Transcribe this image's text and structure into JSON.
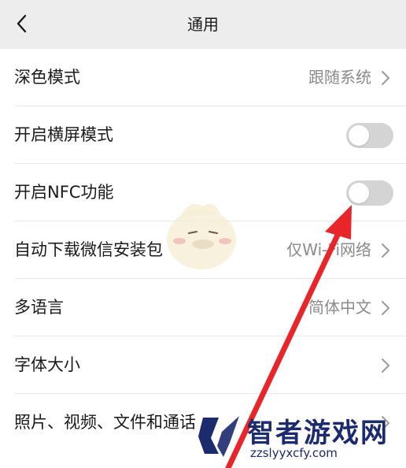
{
  "header": {
    "title": "通用"
  },
  "settings": [
    {
      "label": "深色模式",
      "value": "跟随系统",
      "type": "nav"
    },
    {
      "label": "开启横屏模式",
      "type": "toggle",
      "on": false
    },
    {
      "label": "开启NFC功能",
      "type": "toggle",
      "on": false
    },
    {
      "label": "自动下载微信安装包",
      "value": "仅Wi-Fi网络",
      "type": "nav"
    },
    {
      "label": "多语言",
      "value": "简体中文",
      "type": "nav"
    },
    {
      "label": "字体大小",
      "type": "nav"
    },
    {
      "label": "照片、视频、文件和通话",
      "type": "nav"
    }
  ],
  "watermark": {
    "name": "智者游戏网",
    "url": "zzslyyxcfy.com"
  },
  "colors": {
    "header_bg": "#ededed",
    "toggle_off": "#d4d4d4",
    "arrow": "#e8262a",
    "watermark": "#1c2a6e"
  }
}
